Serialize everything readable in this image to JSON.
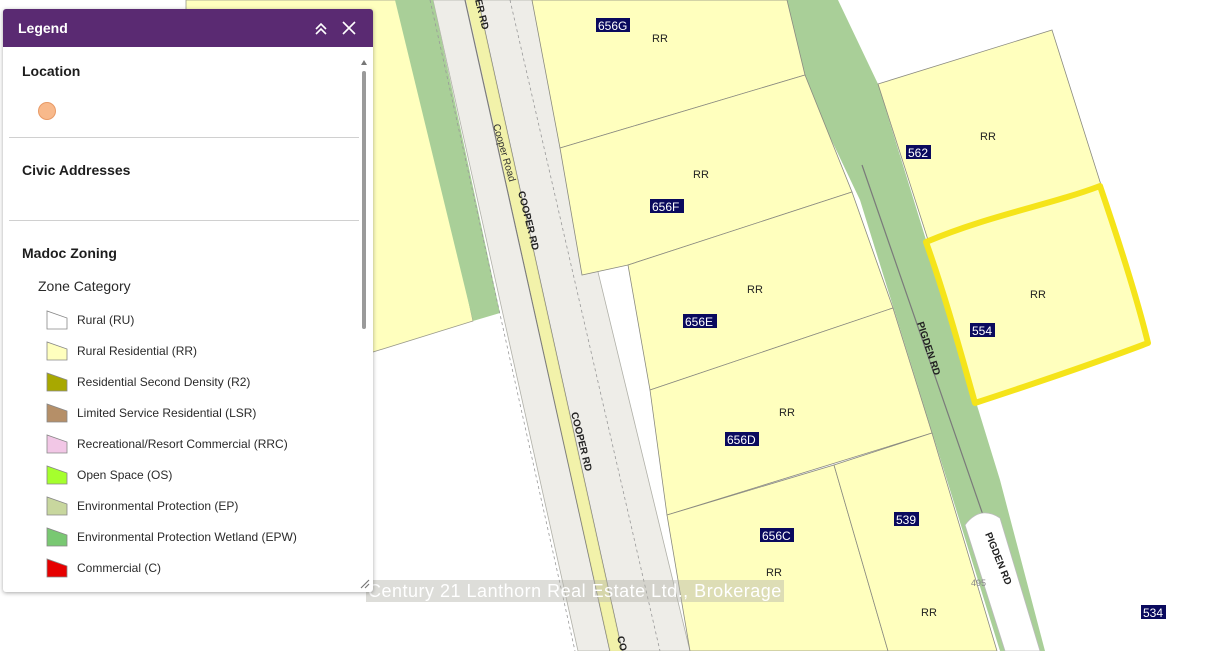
{
  "legend": {
    "title": "Legend",
    "sections": {
      "location": "Location",
      "civic": "Civic Addresses",
      "zoning": "Madoc Zoning"
    },
    "zone_category": "Zone Category",
    "items": [
      {
        "label": "Rural (RU)",
        "color": "#ffffff"
      },
      {
        "label": "Rural Residential (RR)",
        "color": "#ffffbe"
      },
      {
        "label": "Residential Second Density (R2)",
        "color": "#a8a800"
      },
      {
        "label": "Limited Service Residential (LSR)",
        "color": "#b58f68"
      },
      {
        "label": "Recreational/Resort Commercial (RRC)",
        "color": "#f2c7e6"
      },
      {
        "label": "Open Space (OS)",
        "color": "#a5ff2d"
      },
      {
        "label": "Environmental Protection (EP)",
        "color": "#c8d79e"
      },
      {
        "label": "Environmental Protection Wetland (EPW)",
        "color": "#79c872"
      },
      {
        "label": "Commercial (C)",
        "color": "#e60000"
      }
    ],
    "location_color": "#f8b98b"
  },
  "map": {
    "zone_label": "RR",
    "addresses": [
      "656G",
      "656F",
      "656E",
      "656D",
      "656C",
      "562",
      "554",
      "539",
      "534"
    ],
    "roads": {
      "cooper_upper": "COOPER RD",
      "cooper_top": "ER RD",
      "cooper_lower": "COOPER RD",
      "cooper_bottom": "CO",
      "cooper_road": "Cooper Road",
      "pigden": "PIGDEN RD",
      "pigden_lower": "PIGDEN RD",
      "number_495": "495"
    },
    "colors": {
      "rr": "#ffffbe",
      "ep": "#a9cf98",
      "road": "#eeede8",
      "highlight": "#f5e41a"
    }
  },
  "watermark": "Century 21 Lanthorn Real Estate Ltd., Brokerage"
}
